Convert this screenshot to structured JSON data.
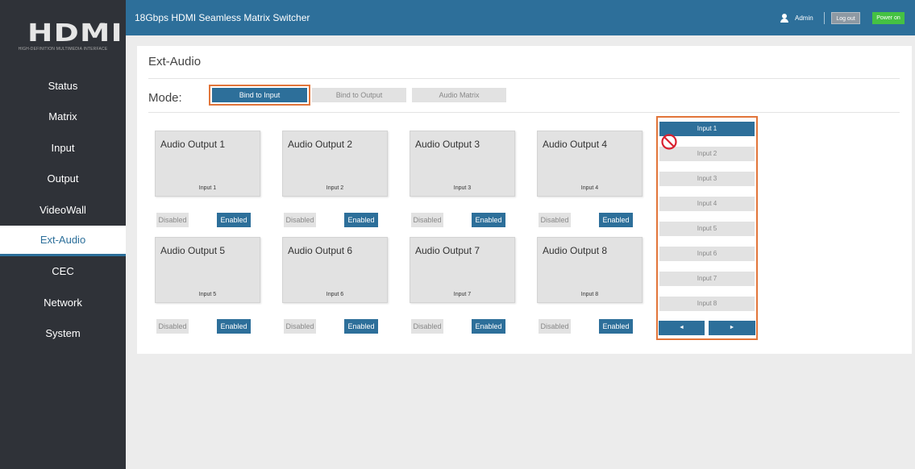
{
  "logo": {
    "text": "HDMI",
    "tm": "™",
    "tagline": "HIGH-DEFINITION MULTIMEDIA INTERFACE"
  },
  "header": {
    "title": "18Gbps HDMI Seamless Matrix Switcher",
    "user": "Admin",
    "logout_label": "Log out",
    "power_label": "Power on"
  },
  "sidebar": {
    "items": [
      {
        "label": "Status"
      },
      {
        "label": "Matrix"
      },
      {
        "label": "Input"
      },
      {
        "label": "Output"
      },
      {
        "label": "VideoWall"
      },
      {
        "label": "Ext-Audio"
      },
      {
        "label": "CEC"
      },
      {
        "label": "Network"
      },
      {
        "label": "System"
      }
    ],
    "active": "Ext-Audio"
  },
  "page": {
    "title": "Ext-Audio",
    "mode_label": "Mode:",
    "modes": [
      {
        "label": "Bind to Input",
        "active": true
      },
      {
        "label": "Bind to Output",
        "active": false
      },
      {
        "label": "Audio Matrix",
        "active": false
      }
    ]
  },
  "outputs": [
    {
      "name": "Audio Output 1",
      "input": "Input 1",
      "disabled_label": "Disabled",
      "enabled_label": "Enabled"
    },
    {
      "name": "Audio Output 2",
      "input": "Input 2",
      "disabled_label": "Disabled",
      "enabled_label": "Enabled"
    },
    {
      "name": "Audio Output 3",
      "input": "Input 3",
      "disabled_label": "Disabled",
      "enabled_label": "Enabled"
    },
    {
      "name": "Audio Output 4",
      "input": "Input 4",
      "disabled_label": "Disabled",
      "enabled_label": "Enabled"
    },
    {
      "name": "Audio Output 5",
      "input": "Input 5",
      "disabled_label": "Disabled",
      "enabled_label": "Enabled"
    },
    {
      "name": "Audio Output 6",
      "input": "Input 6",
      "disabled_label": "Disabled",
      "enabled_label": "Enabled"
    },
    {
      "name": "Audio Output 7",
      "input": "Input 7",
      "disabled_label": "Disabled",
      "enabled_label": "Enabled"
    },
    {
      "name": "Audio Output 8",
      "input": "Input 8",
      "disabled_label": "Disabled",
      "enabled_label": "Enabled"
    }
  ],
  "inputs": [
    {
      "label": "Input 1",
      "active": true
    },
    {
      "label": "Input 2",
      "active": false
    },
    {
      "label": "Input 3",
      "active": false
    },
    {
      "label": "Input 4",
      "active": false
    },
    {
      "label": "Input 5",
      "active": false
    },
    {
      "label": "Input 6",
      "active": false
    },
    {
      "label": "Input 7",
      "active": false
    },
    {
      "label": "Input 8",
      "active": false
    }
  ],
  "pager": {
    "prev": "◄",
    "next": "►"
  },
  "colors": {
    "accent": "#2d6f9a",
    "sidebar": "#2f3238",
    "highlight": "#e2753a",
    "power": "#45c143",
    "forbidden": "#d9202f"
  },
  "icons": {
    "user": "user-icon",
    "forbidden": "no-entry-icon",
    "prev": "arrow-left-icon",
    "next": "arrow-right-icon"
  }
}
